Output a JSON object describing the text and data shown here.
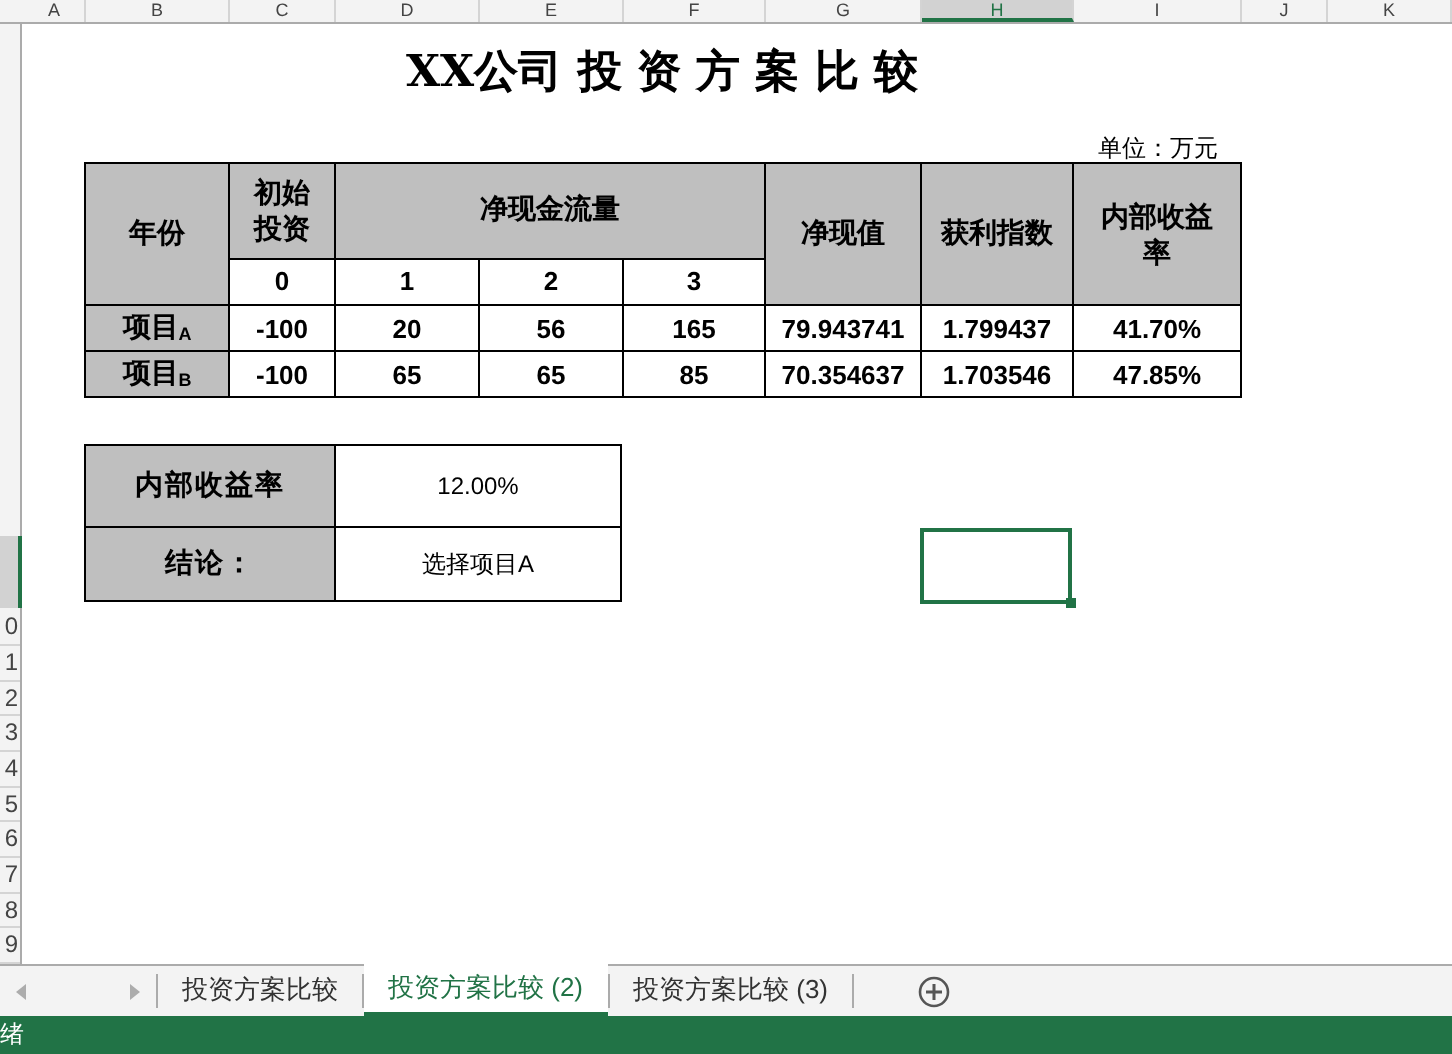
{
  "columns": [
    {
      "label": "A",
      "selected": false
    },
    {
      "label": "B",
      "selected": false
    },
    {
      "label": "C",
      "selected": false
    },
    {
      "label": "D",
      "selected": false
    },
    {
      "label": "E",
      "selected": false
    },
    {
      "label": "F",
      "selected": false
    },
    {
      "label": "G",
      "selected": false
    },
    {
      "label": "H",
      "selected": true
    },
    {
      "label": "I",
      "selected": false
    },
    {
      "label": "J",
      "selected": false
    },
    {
      "label": "K",
      "selected": false
    }
  ],
  "row_headers": [
    "0",
    "1",
    "2",
    "3",
    "4",
    "5",
    "6",
    "7",
    "8",
    "9"
  ],
  "title": "XX公司 投 资 方 案 比 较",
  "unit": "单位：万元",
  "table": {
    "year": "年份",
    "initial": "初始投资",
    "cash_flow": "净现金流量",
    "npv": "净现值",
    "pi": "获利指数",
    "irr": "内部收益率",
    "periods": [
      "0",
      "1",
      "2",
      "3"
    ],
    "rows": [
      {
        "name": "项目$_{A}$",
        "flows": [
          "-100",
          "20",
          "56",
          "165"
        ],
        "npv": "79.943741",
        "pi": "1.799437",
        "irr": "41.70%"
      },
      {
        "name": "项目$_{B}$",
        "flows": [
          "-100",
          "65",
          "65",
          "85"
        ],
        "npv": "70.354637",
        "pi": "1.703546",
        "irr": "47.85%"
      }
    ]
  },
  "summary": [
    {
      "label": "内部收益率",
      "value": "12.00%"
    },
    {
      "label": "结论：",
      "value": "选择项目A"
    }
  ],
  "sheet_tabs": [
    {
      "label": "投资方案比较",
      "selected": false
    },
    {
      "label": "投资方案比较 (2)",
      "selected": true
    },
    {
      "label": "投资方案比较 (3)",
      "selected": false
    }
  ],
  "status": "绪"
}
